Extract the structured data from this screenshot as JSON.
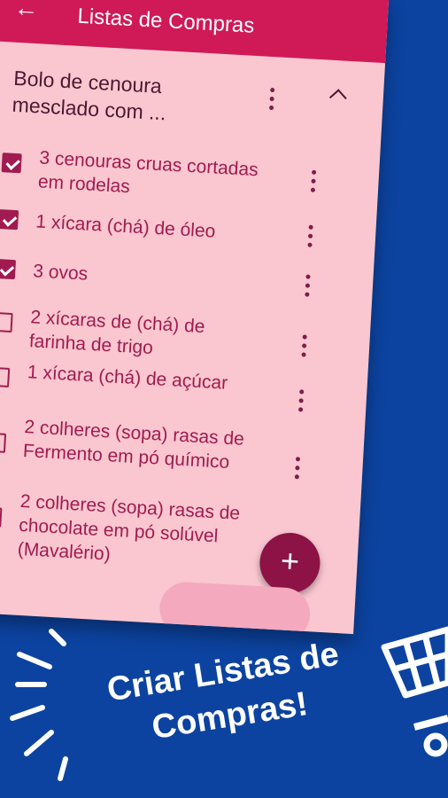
{
  "header": {
    "back_icon": "arrow-left-icon",
    "title": "Listas de Compras"
  },
  "list": {
    "title": "Bolo de cenoura mesclado com ...",
    "menu_icon": "more-vert-icon",
    "collapse_icon": "chevron-up-icon"
  },
  "items": [
    {
      "text": "3 cenouras cruas cortadas em rodelas",
      "checked": true
    },
    {
      "text": "1 xícara (chá) de óleo",
      "checked": true
    },
    {
      "text": "3 ovos",
      "checked": true
    },
    {
      "text": "2 xícaras de (chá) de farinha de trigo",
      "checked": false
    },
    {
      "text": "1 xícara (chá) de açúcar",
      "checked": false
    },
    {
      "text": "2 colheres (sopa) rasas de Fermento em pó químico",
      "checked": false
    },
    {
      "text": "2 colheres (sopa) rasas de chocolate em pó solúvel (Mavalério)",
      "checked": false
    }
  ],
  "fab": {
    "label": "+"
  },
  "promo": {
    "line1": "Criar Listas de",
    "line2": "Compras!"
  },
  "colors": {
    "background": "#0c43a0",
    "appbar": "#cf1a57",
    "card": "#fac7d0",
    "accent": "#a11b50",
    "fab": "#8d1346"
  }
}
